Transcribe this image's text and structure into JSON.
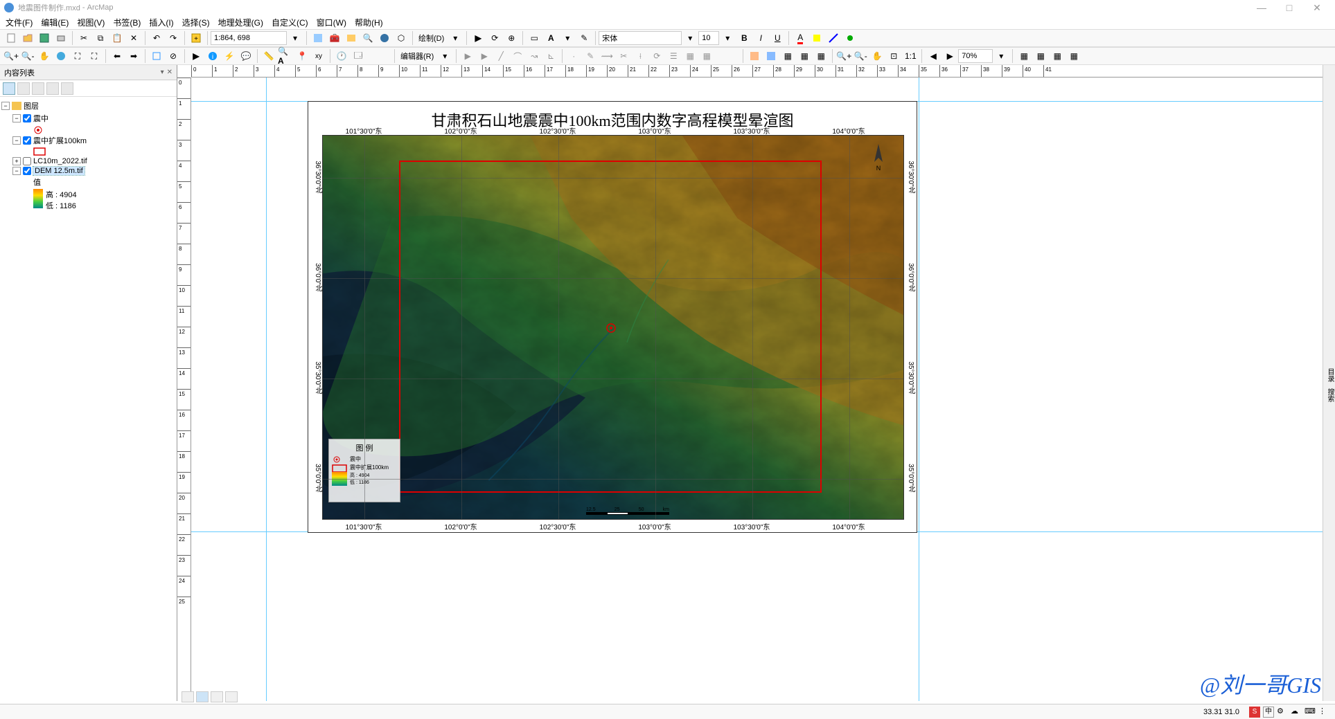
{
  "titlebar": {
    "doc": "地震图件制作.mxd",
    "app": "ArcMap"
  },
  "menus": [
    "文件(F)",
    "编辑(E)",
    "视图(V)",
    "书签(B)",
    "插入(I)",
    "选择(S)",
    "地理处理(G)",
    "自定义(C)",
    "窗口(W)",
    "帮助(H)"
  ],
  "toolbar1": {
    "scale": "1:864, 698",
    "draw_label": "绘制(D)",
    "font": "宋体",
    "fontsize": "10"
  },
  "toolbar2": {
    "editor_label": "编辑器(R)",
    "zoom_pct": "70%"
  },
  "toc": {
    "title": "内容列表",
    "root": "图层",
    "layers": [
      {
        "name": "震中",
        "checked": true,
        "symbol": "epicenter"
      },
      {
        "name": "震中扩展100km",
        "checked": true,
        "symbol": "bbox"
      },
      {
        "name": "LC10m_2022.tif",
        "checked": false,
        "symbol": null
      },
      {
        "name": "DEM 12.5m.tif",
        "checked": true,
        "symbol": "raster",
        "selected": true
      }
    ],
    "raster_legend": {
      "value_label": "值",
      "high": "高 : 4904",
      "low": "低 : 1186"
    }
  },
  "map": {
    "title": "甘肃积石山地震震中100km范围内数字高程模型晕渲图",
    "lon_labels": [
      "101°30'0\"东",
      "102°0'0\"东",
      "102°30'0\"东",
      "103°0'0\"东",
      "103°30'0\"东",
      "104°0'0\"东"
    ],
    "lat_labels": [
      "35°0'0\"北",
      "35°30'0\"北",
      "36°0'0\"北",
      "36°30'0\"北"
    ],
    "legend": {
      "title": "图 例",
      "items": [
        {
          "label": "震中",
          "sym": "epicenter"
        },
        {
          "label": "震中扩展100km",
          "sym": "bbox"
        },
        {
          "label": "高 : 4904",
          "sym": "grad"
        },
        {
          "label": "低 : 1186",
          "sym": "grad2"
        }
      ]
    },
    "scalebar": {
      "vals": [
        "12.5",
        "25",
        "50"
      ],
      "unit": "km"
    }
  },
  "ruler_h": [
    0,
    1,
    2,
    3,
    4,
    5,
    6,
    7,
    8,
    9,
    10,
    11,
    12,
    13,
    14,
    15,
    16,
    17,
    18,
    19,
    20,
    21,
    22,
    23,
    24,
    25,
    26,
    27,
    28,
    29,
    30,
    31,
    32,
    33,
    34,
    35,
    36,
    37,
    38,
    39,
    40,
    41
  ],
  "ruler_v": [
    0,
    1,
    2,
    3,
    4,
    5,
    6,
    7,
    8,
    9,
    10,
    11,
    12,
    13,
    14,
    15,
    16,
    17,
    18,
    19,
    20,
    21,
    22,
    23,
    24,
    25
  ],
  "right_panel": {
    "label1": "目录",
    "label2": "搜索"
  },
  "statusbar": {
    "coords": "33.31  31.0"
  },
  "watermark": "@刘一哥GIS",
  "ime": {
    "lang": "中",
    "brand": "S"
  }
}
